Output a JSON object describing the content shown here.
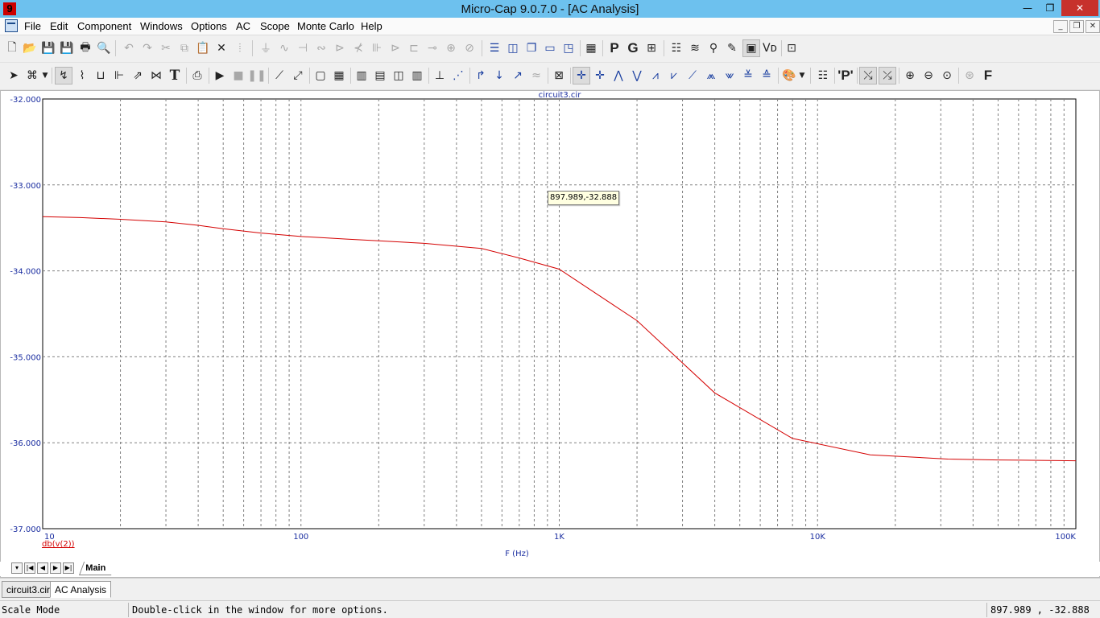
{
  "window": {
    "title": "Micro-Cap 9.0.7.0 - [AC Analysis]",
    "app_icon_glyph": "9",
    "minimize_glyph": "—",
    "restore_glyph": "❐",
    "close_glyph": "✕"
  },
  "menu": {
    "items": [
      "File",
      "Edit",
      "Component",
      "Windows",
      "Options",
      "AC",
      "Scope",
      "Monte Carlo",
      "Help"
    ],
    "mdi_minimize": "_",
    "mdi_restore": "❐",
    "mdi_close": "✕"
  },
  "toolbar1": {
    "letter_p": "P",
    "letter_g": "G"
  },
  "toolbar2": {
    "letter_p_quoted": "'P'",
    "letter_f": "F",
    "text_tool": "T"
  },
  "colors": {
    "curve": "#d40000",
    "axis_text": "#1a2da0",
    "grid": "#808080",
    "title_bar": "#6dc1ee",
    "close_button": "#c7312c"
  },
  "chart_data": {
    "type": "line",
    "title": "circuit3.cir",
    "xlabel": "F (Hz)",
    "ylabel": "",
    "x_scale": "log",
    "xlim": [
      10,
      100000
    ],
    "ylim": [
      -37.0,
      -32.0
    ],
    "x_tick_labels": [
      "10",
      "100",
      "1K",
      "10K",
      "100K"
    ],
    "y_tick_labels": [
      "-32.000",
      "-33.000",
      "-34.000",
      "-35.000",
      "-36.000",
      "-37.000"
    ],
    "grid": true,
    "series": [
      {
        "name": "db(v(2))",
        "color": "#d40000",
        "x": [
          10,
          14,
          20,
          30,
          40,
          50,
          70,
          100,
          150,
          200,
          300,
          500,
          700,
          1000,
          2000,
          4000,
          8000,
          16000,
          32000,
          50000,
          100000
        ],
        "y": [
          -33.37,
          -33.38,
          -33.4,
          -33.43,
          -33.47,
          -33.51,
          -33.56,
          -33.6,
          -33.63,
          -33.65,
          -33.68,
          -33.74,
          -33.85,
          -33.98,
          -34.58,
          -35.42,
          -35.95,
          -36.14,
          -36.19,
          -36.2,
          -36.21
        ]
      }
    ]
  },
  "cursor": {
    "readout": "897.989,-32.888"
  },
  "tabs": {
    "page": "Main",
    "windows": [
      "circuit3.cir",
      "AC Analysis"
    ]
  },
  "status": {
    "mode": "Scale Mode",
    "hint": "Double-click in the window for more options.",
    "coords": "897.989 , -32.888"
  }
}
